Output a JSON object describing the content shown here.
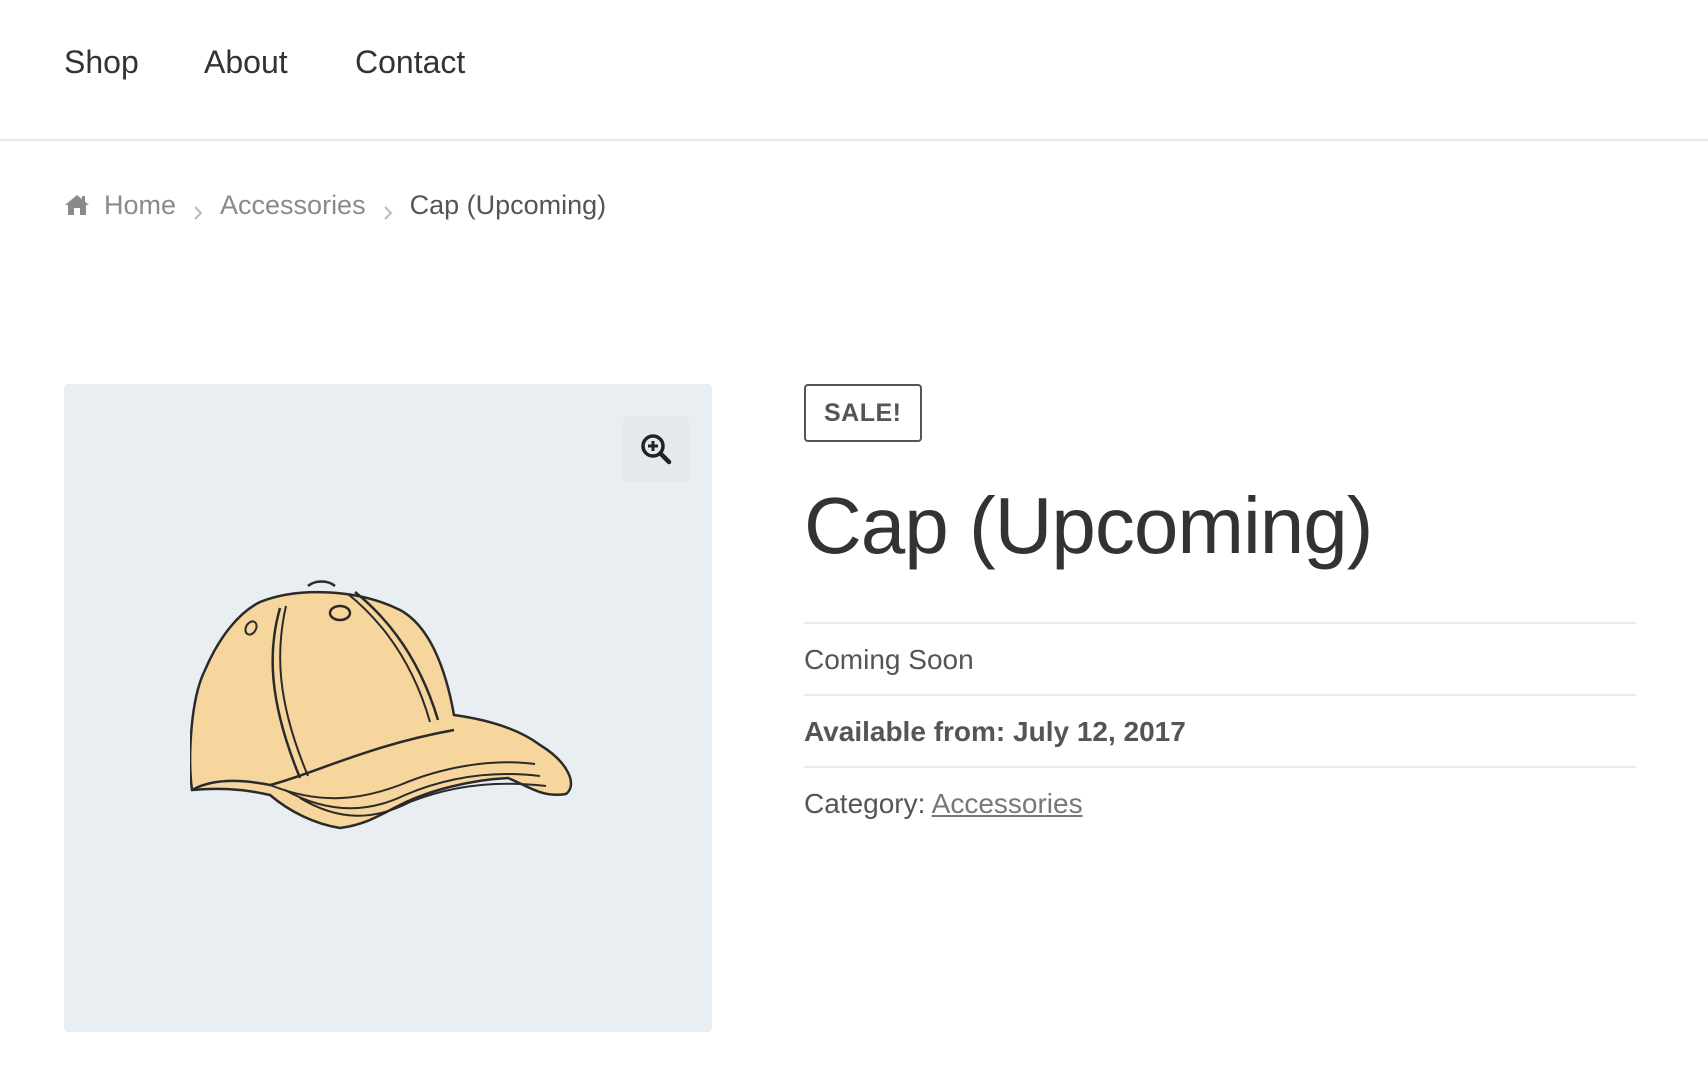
{
  "nav": {
    "items": [
      {
        "label": "Shop"
      },
      {
        "label": "About"
      },
      {
        "label": "Contact"
      }
    ]
  },
  "breadcrumb": {
    "home_icon": "home-icon",
    "items": [
      {
        "label": "Home"
      },
      {
        "label": "Accessories"
      },
      {
        "label": "Cap (Upcoming)"
      }
    ]
  },
  "gallery": {
    "zoom_icon": "zoom-in-icon",
    "image": "cap-illustration",
    "colors": {
      "background": "#e9eef3",
      "cap_fill": "#f6d69c"
    }
  },
  "product": {
    "badge": "SALE!",
    "title": "Cap (Upcoming)",
    "status": "Coming Soon",
    "availability": "Available from: July 12, 2017",
    "category_label": "Category:",
    "category_value": "Accessories"
  }
}
